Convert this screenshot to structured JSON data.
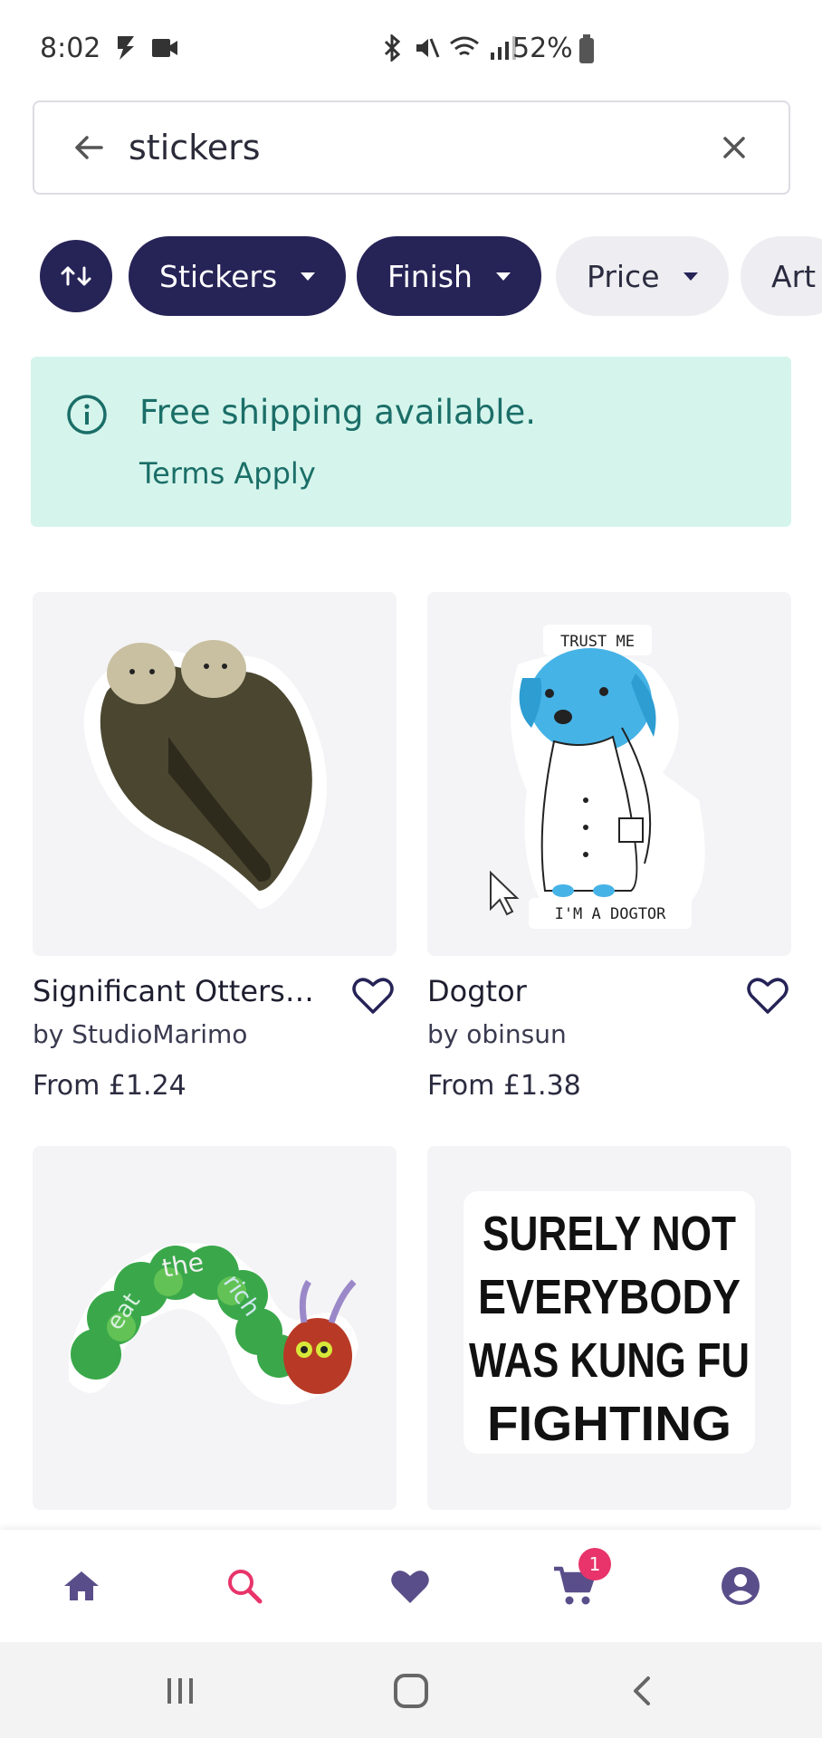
{
  "status_bar": {
    "time": "8:02",
    "battery": "52%"
  },
  "search": {
    "value": "stickers",
    "placeholder": ""
  },
  "filters": [
    {
      "label": "Stickers"
    },
    {
      "label": "Finish"
    },
    {
      "label": "Price"
    },
    {
      "label": "Art"
    }
  ],
  "banner": {
    "title": "Free shipping available.",
    "link": "Terms Apply"
  },
  "products": [
    {
      "title": "Significant Otters - Couple Otters",
      "artist": "by StudioMarimo",
      "price": "From £1.24"
    },
    {
      "title": "Dogtor",
      "artist": "by obinsun",
      "price": "From £1.38"
    },
    {
      "title": "",
      "artist": "",
      "price": ""
    },
    {
      "title": "",
      "artist": "",
      "price": ""
    }
  ],
  "stickers": {
    "dog_top": "TRUST ME",
    "dog_bottom": "I'M A DOGTOR",
    "caterpillar": [
      "eat",
      "the",
      "rich"
    ],
    "kungfu": [
      "SURELY NOT",
      "EVERYBODY",
      "WAS KUNG FU",
      "FIGHTING"
    ]
  },
  "nav": {
    "cart_count": "1",
    "active": "search"
  },
  "colors": {
    "brand_dark": "#262357",
    "accent_pink": "#e8346a",
    "banner_bg": "#d5f5ec",
    "banner_text": "#1b6e68",
    "nav_icon": "#5a4e8a"
  }
}
